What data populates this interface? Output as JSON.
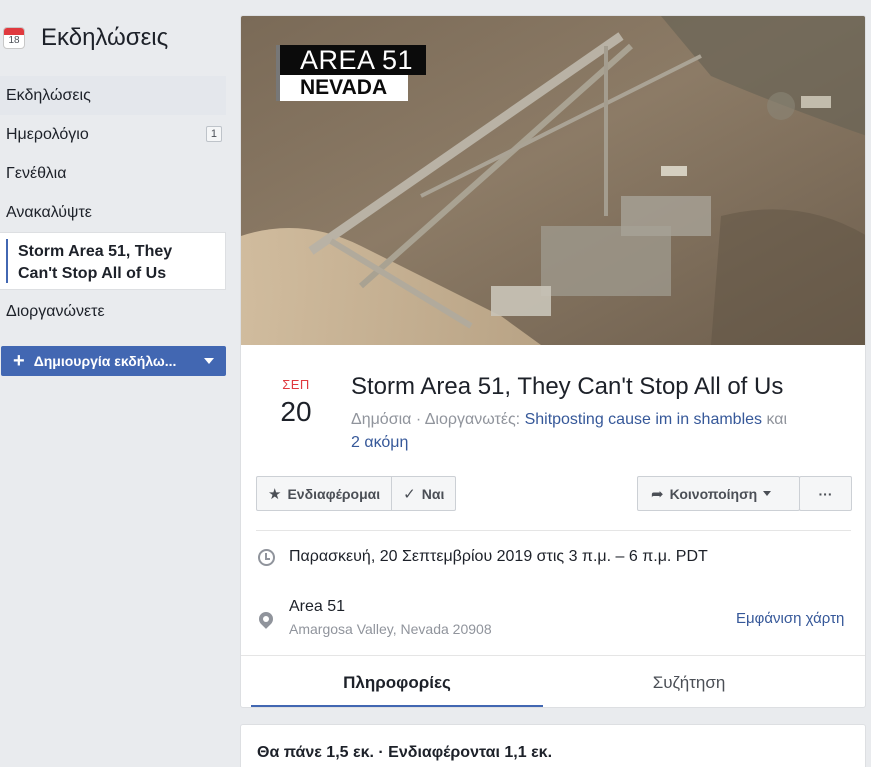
{
  "sidebar": {
    "header_icon": "calendar-icon",
    "calendar_number": "18",
    "title": "Εκδηλώσεις",
    "items": [
      {
        "label": "Εκδηλώσεις"
      },
      {
        "label": "Ημερολόγιο",
        "badge": "1"
      },
      {
        "label": "Γενέθλια"
      },
      {
        "label": "Ανακαλύψτε"
      }
    ],
    "selected_event": {
      "line1": "Storm Area 51, They",
      "line2": "Can't Stop All of Us"
    },
    "organize": "Διοργανώνετε",
    "create_button": "Δημιουργία εκδήλω..."
  },
  "event": {
    "cover": {
      "line1": "AREA 51",
      "line2": "NEVADA"
    },
    "month": "ΣΕΠ",
    "day": "20",
    "title": "Storm Area 51, They Can't Stop All of Us",
    "privacy": "Δημόσια",
    "organizers_label": "Διοργανωτές:",
    "organizer": "Shitposting cause im in shambles",
    "and_more_word": "και",
    "and_more": "2 ακόμη",
    "buttons": {
      "interested": "Ενδιαφέρομαι",
      "going": "Ναι",
      "share": "Κοινοποίηση",
      "more": "···"
    },
    "datetime": "Παρασκευή, 20 Σεπτεμβρίου 2019 στις 3 π.μ. – 6 π.μ. PDT",
    "location_name": "Area 51",
    "location_address": "Amargosa Valley, Nevada 20908",
    "show_map": "Εμφάνιση χάρτη",
    "tabs": [
      {
        "label": "Πληροφορίες"
      },
      {
        "label": "Συζήτηση"
      }
    ],
    "stats": "Θα πάνε 1,5 εκ. · Ενδιαφέρονται 1,1 εκ."
  },
  "colors": {
    "accent": "#4267b2",
    "link": "#365899",
    "date_red": "#e0393e"
  }
}
